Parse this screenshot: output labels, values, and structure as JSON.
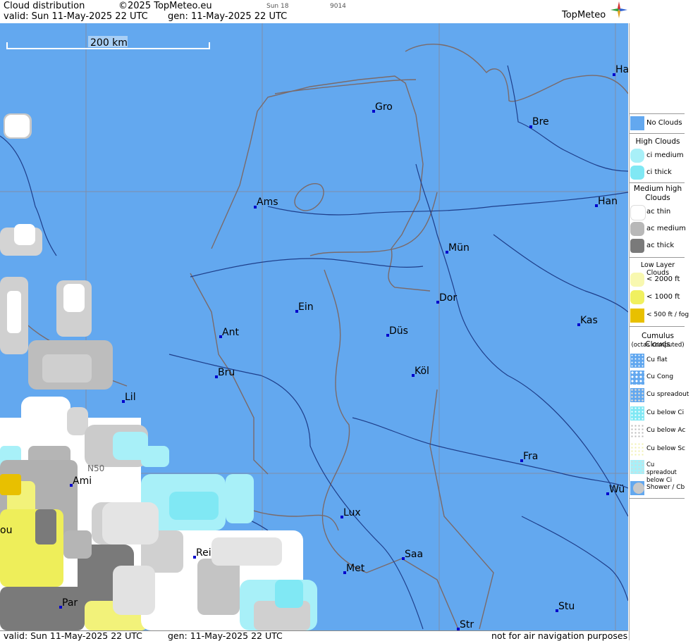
{
  "header": {
    "title": "Cloud distribution",
    "copyright": "©2025 TopMeteo.eu",
    "small1": "Sun 18",
    "small2": "9014",
    "valid": "valid:  Sun  11-May-2025  22 UTC",
    "gen": "gen: 11-May-2025 22 UTC",
    "logo": "TopMeteo"
  },
  "footer": {
    "valid": "valid:  Sun  11-May-2025  22 UTC",
    "gen": "gen: 11-May-2025 22 UTC",
    "notice": "not for air navigation purposes"
  },
  "map": {
    "scale_label": "200 km",
    "latitude_label": "N50",
    "cities": [
      {
        "id": "gro",
        "name": "Gro"
      },
      {
        "id": "bre",
        "name": "Bre"
      },
      {
        "id": "ha",
        "name": "Ha"
      },
      {
        "id": "ams",
        "name": "Ams"
      },
      {
        "id": "han",
        "name": "Han"
      },
      {
        "id": "mun",
        "name": "Mün"
      },
      {
        "id": "ein",
        "name": "Ein"
      },
      {
        "id": "dor",
        "name": "Dor"
      },
      {
        "id": "ant",
        "name": "Ant"
      },
      {
        "id": "dus",
        "name": "Düs"
      },
      {
        "id": "kas",
        "name": "Kas"
      },
      {
        "id": "bru",
        "name": "Bru"
      },
      {
        "id": "kol",
        "name": "Köl"
      },
      {
        "id": "lil",
        "name": "Lil"
      },
      {
        "id": "fra",
        "name": "Fra"
      },
      {
        "id": "ami",
        "name": "Ami"
      },
      {
        "id": "wu",
        "name": "Wü"
      },
      {
        "id": "lux",
        "name": "Lux"
      },
      {
        "id": "ou",
        "name": "ou"
      },
      {
        "id": "rei",
        "name": "Rei"
      },
      {
        "id": "saa",
        "name": "Saa"
      },
      {
        "id": "met",
        "name": "Met"
      },
      {
        "id": "par",
        "name": "Par"
      },
      {
        "id": "stu",
        "name": "Stu"
      },
      {
        "id": "str",
        "name": "Str"
      }
    ]
  },
  "legend": {
    "no_clouds": "No Clouds",
    "high_head": "High Clouds",
    "ci_medium": "ci medium",
    "ci_thick": "ci thick",
    "medium_head": "Medium high Clouds",
    "ac_thin": "ac thin",
    "ac_medium": "ac medium",
    "ac_thick": "ac thick",
    "low_head": "Low Layer Clouds",
    "low_2000": "< 2000 ft",
    "low_1000": "< 1000 ft",
    "low_500": "< 500 ft / fog",
    "cumulus_head": "Cumulus Clouds",
    "cumulus_sub": "(octas computed)",
    "cu_flat": "Cu flat",
    "cu_cong": "Cu Cong",
    "cu_spreadout": "Cu spreadout",
    "cu_below_ci": "Cu below Ci",
    "cu_below_ac": "Cu below Ac",
    "cu_below_sc": "Cu below Sc",
    "cu_spread_below_ci": "Cu spreadout below Ci",
    "shower": "Shower / Cb"
  },
  "colors": {
    "no_clouds": "#63a8ef",
    "ci_medium": "#a8f0f8",
    "ci_thick": "#80e8f4",
    "ac_thin": "#ffffff",
    "ac_medium": "#b8b8b8",
    "ac_thick": "#7a7a7a",
    "low_2000": "#f8f8b0",
    "low_1000": "#f0f060",
    "low_500": "#e8c000",
    "city_marker": "#0000cc",
    "border": "#7a6a6a",
    "river": "#1e3e8a"
  }
}
